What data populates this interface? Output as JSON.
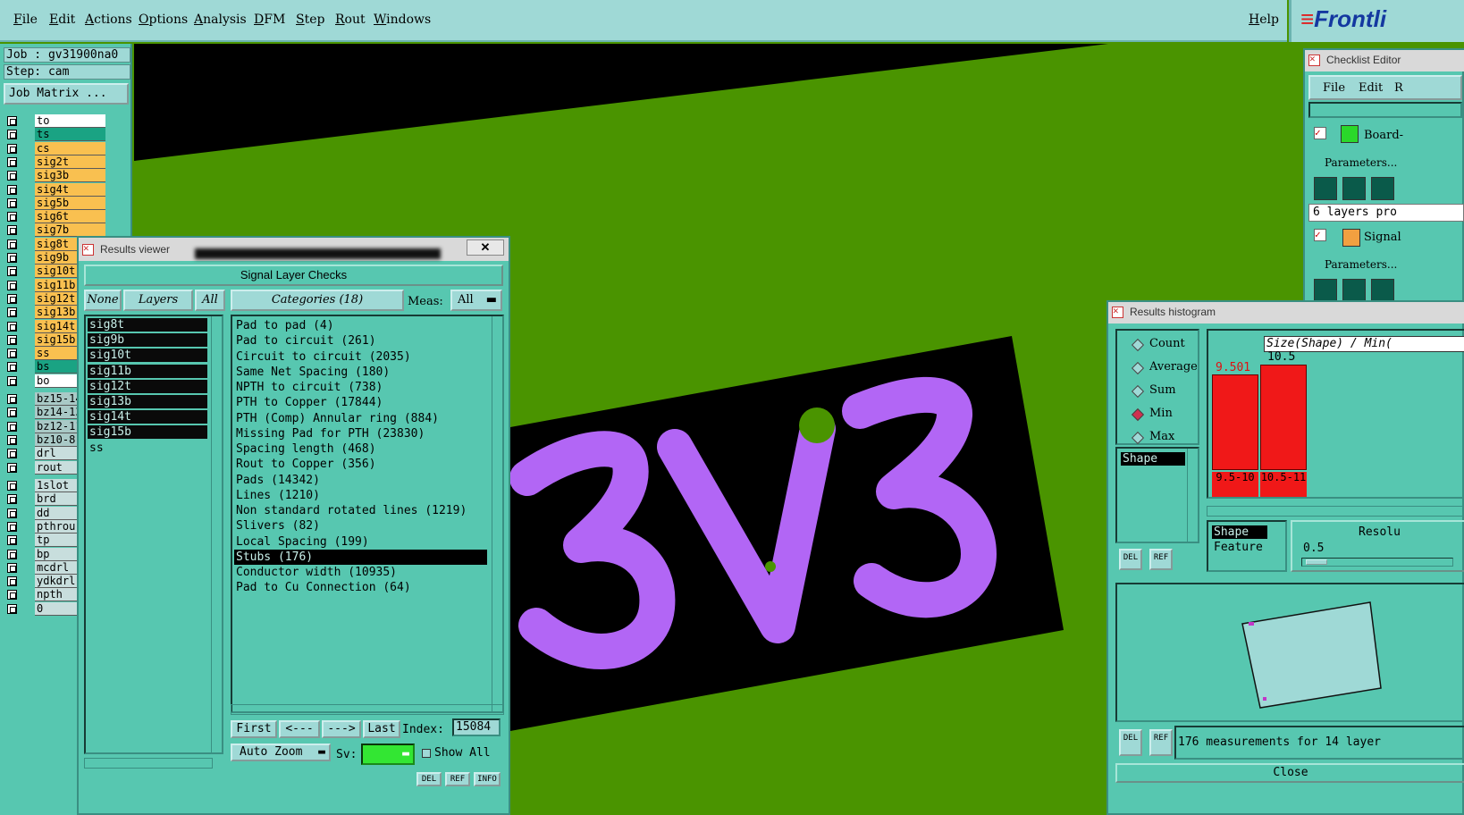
{
  "menubar": {
    "items": [
      "File",
      "Edit",
      "Actions",
      "Options",
      "Analysis",
      "DFM",
      "Step",
      "Rout",
      "Windows"
    ],
    "help": "Help",
    "logo": "Frontli"
  },
  "job": {
    "job_line": "Job : gv31900na0",
    "step_line": "Step: cam",
    "matrix_button": "Job Matrix ..."
  },
  "layers": [
    {
      "name": "to",
      "color": "#ffffff"
    },
    {
      "name": "ts",
      "color": "#1aa383"
    },
    {
      "name": "cs",
      "color": "#f9c050"
    },
    {
      "name": "sig2t",
      "color": "#f9c050"
    },
    {
      "name": "sig3b",
      "color": "#f9c050"
    },
    {
      "name": "sig4t",
      "color": "#f9c050"
    },
    {
      "name": "sig5b",
      "color": "#f9c050"
    },
    {
      "name": "sig6t",
      "color": "#f9c050"
    },
    {
      "name": "sig7b",
      "color": "#f9c050"
    },
    {
      "name": "sig8t",
      "color": "#f9c050"
    },
    {
      "name": "sig9b",
      "color": "#f9c050"
    },
    {
      "name": "sig10t",
      "color": "#f9c050"
    },
    {
      "name": "sig11b",
      "color": "#f9c050"
    },
    {
      "name": "sig12t",
      "color": "#f9c050"
    },
    {
      "name": "sig13b",
      "color": "#f9c050"
    },
    {
      "name": "sig14t",
      "color": "#f9c050"
    },
    {
      "name": "sig15b",
      "color": "#f9c050"
    },
    {
      "name": "ss",
      "color": "#f9c050"
    },
    {
      "name": "bs",
      "color": "#1aa383"
    },
    {
      "name": "bo",
      "color": "#ffffff"
    }
  ],
  "layers2": [
    "bz15-14",
    "bz14-13",
    "bz12-11",
    "bz10-8",
    "drl",
    "rout"
  ],
  "layers3": [
    "1slot",
    "brd",
    "dd",
    "pthrou",
    "tp",
    "bp",
    "mcdrl",
    "ydkdrl",
    "npth",
    "0"
  ],
  "results_viewer": {
    "title": "Results viewer",
    "close": "✕",
    "heading": "Signal Layer Checks",
    "none_btn": "None",
    "layers_btn": "Layers",
    "all_btn": "All",
    "categories_btn": "Categories (18)",
    "meas_label": "Meas:",
    "meas_value": "All",
    "layer_list": [
      "sig8t",
      "sig9b",
      "sig10t",
      "sig11b",
      "sig12t",
      "sig13b",
      "sig14t",
      "sig15b",
      "ss"
    ],
    "categories": [
      "Pad to pad (4)",
      "Pad to circuit (261)",
      "Circuit to circuit (2035)",
      "Same Net Spacing (180)",
      "NPTH to circuit (738)",
      "PTH to Copper (17844)",
      "PTH (Comp) Annular ring (884)",
      "Missing Pad for PTH (23830)",
      "Spacing length (468)",
      "Rout to Copper (356)",
      "Pads (14342)",
      "Lines (1210)",
      "Non standard rotated lines (1219)",
      "Slivers (82)",
      "Local Spacing (199)",
      "Stubs (176)",
      "Conductor width (10935)",
      "Pad to Cu Connection (64)"
    ],
    "selected_category": "Stubs (176)",
    "first": "First",
    "prev": "<---",
    "next": "--->",
    "last": "Last",
    "index_label": "Index:",
    "index_value": "15084",
    "auto_zoom": "Auto Zoom",
    "sv_label": "Sv:",
    "show_all": "Show All",
    "bottom_btns": [
      "DEL",
      "REF",
      "INFO"
    ]
  },
  "canvas": {
    "text": "3V3",
    "trace_color": "#b266f5",
    "board_color": "#4a9400"
  },
  "checklist_editor": {
    "title": "Checklist Editor",
    "menu": [
      "File",
      "Edit",
      "R"
    ],
    "item1": "Board-",
    "params1": "Parameters...",
    "info": "6 layers pro",
    "item2": "Signal",
    "params2": "Parameters..."
  },
  "histogram": {
    "title": "Results histogram",
    "modes": [
      "Count",
      "Average",
      "Sum",
      "Min",
      "Max"
    ],
    "selected_mode": "Min",
    "shape_item": "Shape",
    "header": "Size(Shape) / Min(",
    "bars": [
      {
        "top_label": "9.501",
        "bin": "9.5-10",
        "value": 9.501
      },
      {
        "top_label": "10.5",
        "bin": "10.5-11",
        "value": 10.5
      }
    ],
    "field_list": [
      "Shape",
      "Feature"
    ],
    "resolution_label": "Resolu",
    "resolution_value": "0.5",
    "status": "176 measurements for 14 layer",
    "close": "Close",
    "del": "DEL",
    "ref": "REF"
  }
}
